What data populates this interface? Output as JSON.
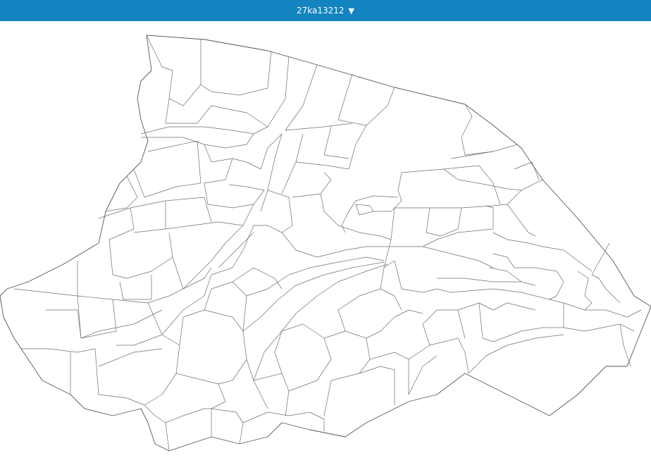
{
  "header": {
    "area_code": "27ka13212",
    "dropdown_glyph": "▼",
    "bar_color": "#1384bf"
  },
  "map": {
    "line_color": "#6e6e6e",
    "background": "#ffffff"
  }
}
